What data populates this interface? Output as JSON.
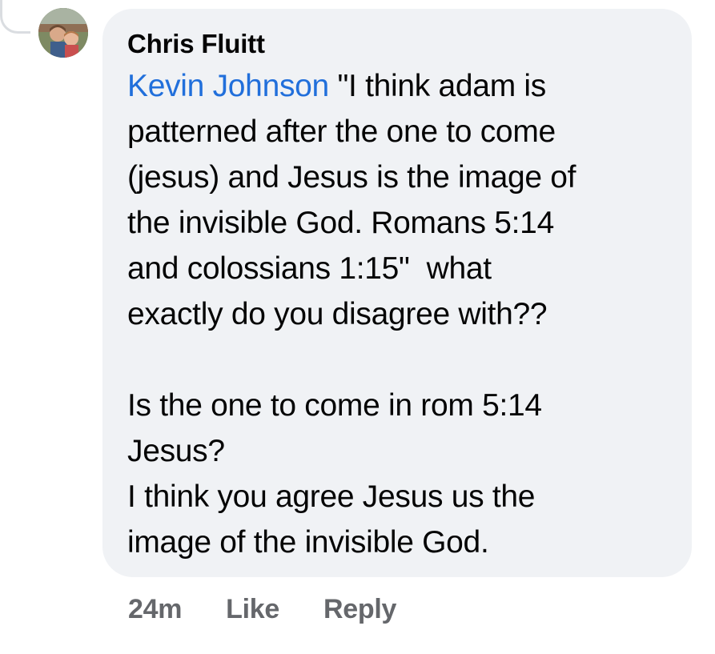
{
  "comment": {
    "author": "Chris Fluitt",
    "mention": "Kevin Johnson",
    "lines": [
      " \"I think adam is",
      "patterned after the one to come",
      "(jesus) and Jesus is the image of",
      "the invisible God. Romans 5:14",
      "and colossians 1:15\"  what",
      "exactly do you disagree with??",
      "",
      "Is the one to come in rom 5:14",
      "Jesus?",
      "I think you agree Jesus us the",
      "image of the invisible God."
    ]
  },
  "actions": {
    "timestamp": "24m",
    "like_label": "Like",
    "reply_label": "Reply"
  },
  "colors": {
    "bubble": "#f0f2f5",
    "mention": "#216fdb",
    "secondary_text": "#65676b"
  }
}
